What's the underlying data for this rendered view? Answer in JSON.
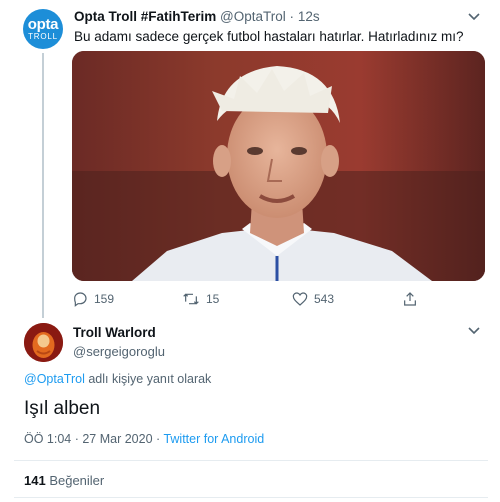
{
  "original_tweet": {
    "avatar_line1": "opta",
    "avatar_line2": "TROLL",
    "display_name": "Opta Troll #FatihTerim",
    "handle": "@OptaTrol",
    "separator": "·",
    "time": "12s",
    "text": "Bu adamı sadece gerçek futbol hastaları hatırlar. Hatırladınız mı?",
    "actions": {
      "replies": "159",
      "retweets": "15",
      "likes": "543"
    },
    "icons": [
      "chevron-down-icon",
      "reply-icon",
      "retweet-icon",
      "like-icon",
      "share-icon"
    ]
  },
  "reply_tweet": {
    "display_name": "Troll Warlord",
    "handle": "@sergeigoroglu",
    "reply_to_handle": "@OptaTrol",
    "reply_to_suffix": " adlı kişiye yanıt olarak",
    "text": "Işıl alben",
    "timestamp": "ÖÖ 1:04 · 27 Mar 2020 · ",
    "source": "Twitter for Android",
    "likes_count": "141",
    "likes_label": " Beğeniler"
  },
  "colors": {
    "accent": "#1d9bf0",
    "secondary_text": "#536471",
    "avatar_opta": "#1d8ed8",
    "avatar_warlord": "#8a1a12"
  }
}
